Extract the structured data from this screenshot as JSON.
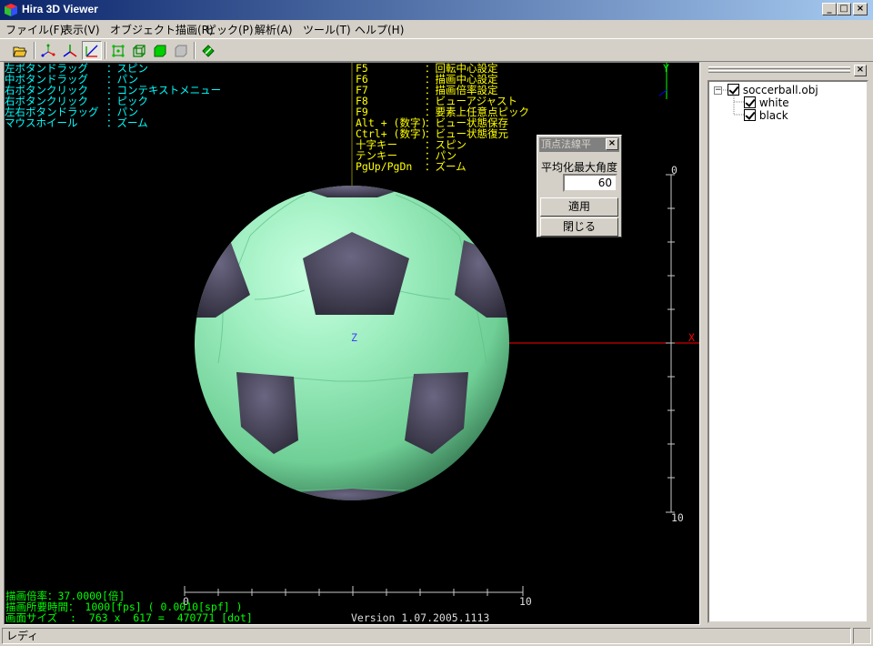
{
  "window": {
    "title": "Hira 3D Viewer",
    "min_label": "_",
    "max_label": "□",
    "close_label": "×"
  },
  "menu": [
    "ファイル(F)",
    "表示(V)",
    "オブジェクト描画(R)",
    "ピック(P)",
    "解析(A)",
    "ツール(T)",
    "ヘルプ(H)"
  ],
  "toolbar": [
    "open-icon",
    "axis-points-icon",
    "axis-xyz-icon",
    "axis-xz-icon",
    "vertex-mesh-icon",
    "wireframe-cube-icon",
    "solid-cube-icon",
    "hidden-cube-icon",
    "pick-arrow-icon"
  ],
  "help_left": [
    {
      "key": "左ボタンドラッグ",
      "val": "：スピン"
    },
    {
      "key": "中ボタンドラッグ",
      "val": "：パン"
    },
    {
      "key": "右ボタンクリック",
      "val": "：コンテキストメニュー"
    },
    {
      "key": "右ボタンクリック",
      "val": "：ピック"
    },
    {
      "key": "左右ボタンドラッグ",
      "val": "：パン"
    },
    {
      "key": "マウスホイール",
      "val": "：ズーム"
    }
  ],
  "help_right": [
    {
      "key": "F5",
      "val": "：回転中心設定"
    },
    {
      "key": "F6",
      "val": "：描画中心設定"
    },
    {
      "key": "F7",
      "val": "：描画倍率設定"
    },
    {
      "key": "F8",
      "val": "：ビューアジャスト"
    },
    {
      "key": "F9",
      "val": "：要素上任意点ピック"
    },
    {
      "key": "Alt + (数字)",
      "val": "：ビュー状態保存"
    },
    {
      "key": "Ctrl+ (数字)",
      "val": "：ビュー状態復元"
    },
    {
      "key": "十字キー",
      "val": "：スピン"
    },
    {
      "key": "テンキー",
      "val": "：パン"
    },
    {
      "key": "PgUp/PgDn",
      "val": "：ズーム"
    }
  ],
  "axis": {
    "y_label": "Y",
    "x_label": "X",
    "z_label": "Z",
    "v_top": "0",
    "v_bottom": "10",
    "h_left": "0",
    "h_right": "10"
  },
  "info": {
    "line1": "描画倍率：37.0000[倍]",
    "line2": "描画所要時間： 1000[fps] ( 0.0010[spf] )",
    "line3": "画面サイズ  :  763 x  617 =  470771 [dot]",
    "version": "Version 1.07.2005.1113"
  },
  "dialog": {
    "title": "頂点法線平",
    "close_label": "×",
    "label": "平均化最大角度",
    "value": "60",
    "apply_label": "適用",
    "close_button_label": "閉じる"
  },
  "panel": {
    "close_label": "×"
  },
  "tree": {
    "root": "soccerball.obj",
    "expander": "−",
    "children": [
      "white",
      "black"
    ]
  },
  "status": {
    "text": "レディ"
  },
  "colors": {
    "ball_light": "#a8f4c8",
    "ball_mid": "#72d69a",
    "ball_dark": "#2e7a50",
    "patch": "#3e3b50",
    "axis_x": "#ff0000",
    "axis_y": "#00ff00",
    "axis_z": "#0000ff"
  }
}
